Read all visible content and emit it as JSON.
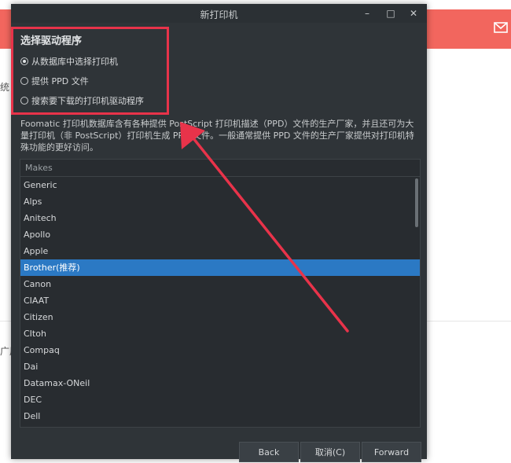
{
  "background": {
    "left_text_1": "统",
    "left_text_2": "广居"
  },
  "dialog": {
    "title": "新打印机",
    "controls": {
      "minimize": "–",
      "maximize": "□",
      "close": "✕"
    },
    "section_title": "选择驱动程序",
    "options": [
      {
        "label": "从数据库中选择打印机",
        "selected": true
      },
      {
        "label": "提供 PPD 文件",
        "selected": false
      },
      {
        "label": "搜索要下载的打印机驱动程序",
        "selected": false
      }
    ],
    "description": "Foomatic 打印机数据库含有各种提供 PostScript 打印机描述（PPD）文件的生产厂家，并且还可为大量打印机（非 PostScript）打印机生成 PPD 文件。一般通常提供 PPD 文件的生产厂家提供对打印机特殊功能的更好访问。",
    "list": {
      "header": "Makes",
      "items": [
        "Generic",
        "Alps",
        "Anitech",
        "Apollo",
        "Apple",
        "Brother(推荐)",
        "Canon",
        "CIAAT",
        "Citizen",
        "CItoh",
        "Compaq",
        "Dai",
        "Datamax-ONeil",
        "DEC",
        "Dell"
      ],
      "selected_index": 5
    },
    "buttons": {
      "back": "Back",
      "cancel": "取消(C)",
      "forward": "Forward"
    }
  },
  "annotation_color": "#e8334a"
}
